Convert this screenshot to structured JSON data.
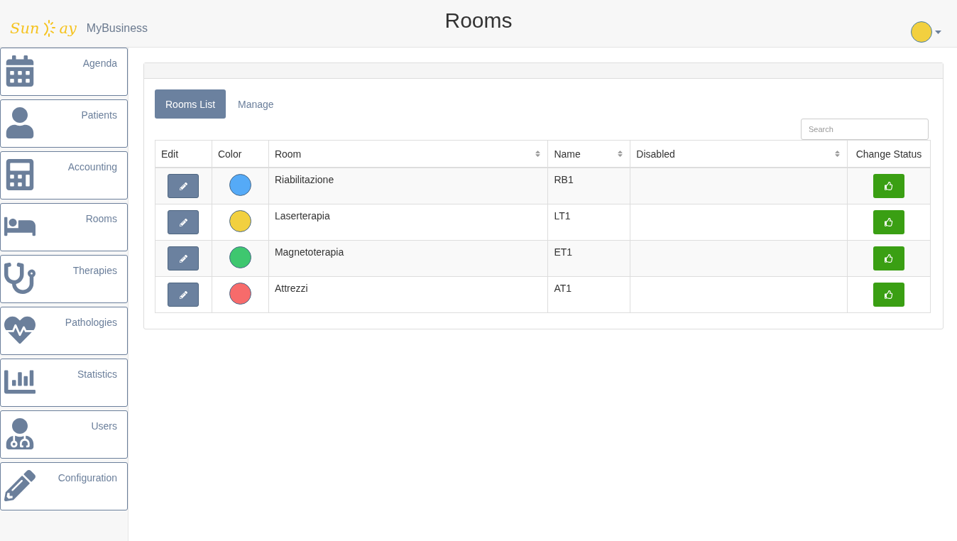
{
  "header": {
    "brand": {
      "first": "Sun",
      "second": "ay"
    },
    "app_name": "MyBusiness",
    "title": "Rooms",
    "avatar": {
      "color": "#f2d03f"
    }
  },
  "sidebar": {
    "items": [
      {
        "label": "Agenda"
      },
      {
        "label": "Patients"
      },
      {
        "label": "Accounting"
      },
      {
        "label": "Rooms"
      },
      {
        "label": "Therapies"
      },
      {
        "label": "Pathologies"
      },
      {
        "label": "Statistics"
      },
      {
        "label": "Users"
      },
      {
        "label": "Configuration"
      }
    ]
  },
  "tabs": [
    {
      "label": "Rooms List",
      "selected": true
    },
    {
      "label": "Manage",
      "selected": false
    }
  ],
  "search": {
    "placeholder": "Search"
  },
  "table": {
    "columns": [
      {
        "label": "Edit",
        "sortable": false
      },
      {
        "label": "Color",
        "sortable": false
      },
      {
        "label": "Room",
        "sortable": true
      },
      {
        "label": "Name",
        "sortable": true
      },
      {
        "label": "Disabled",
        "sortable": true
      },
      {
        "label": "Change Status",
        "sortable": false
      }
    ],
    "rows": [
      {
        "color": "#55aaf7",
        "room": "Riabilitazione",
        "name": "RB1"
      },
      {
        "color": "#f2d03f",
        "room": "Laserterapia",
        "name": "LT1"
      },
      {
        "color": "#3ec76f",
        "room": "Magnetoterapia",
        "name": "ET1"
      },
      {
        "color": "#f76b6b",
        "room": "Attrezzi",
        "name": "AT1"
      }
    ]
  }
}
